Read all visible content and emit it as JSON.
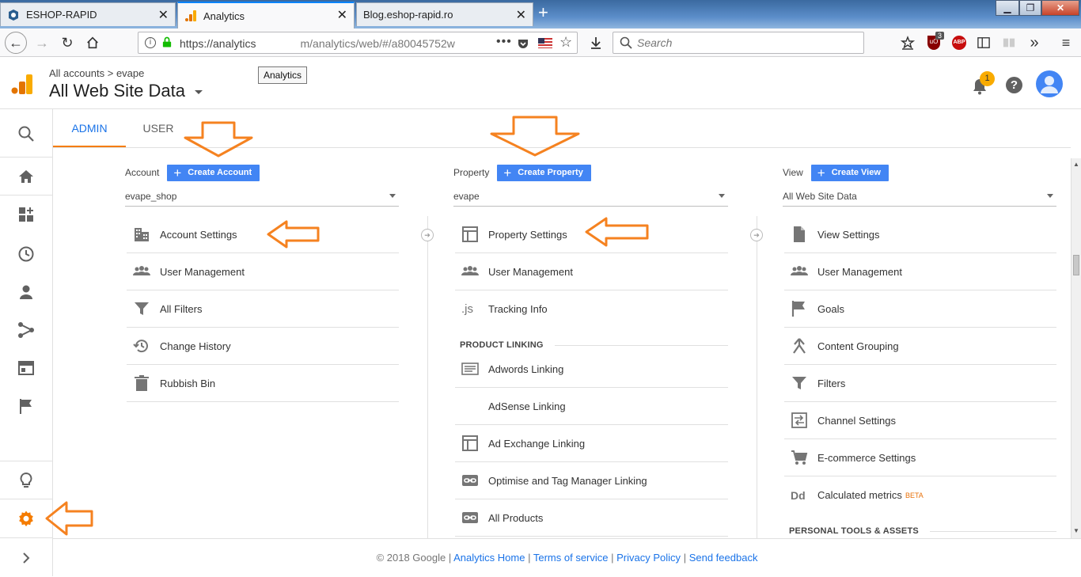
{
  "browser": {
    "tabs": [
      {
        "title": "ESHOP-RAPID"
      },
      {
        "title": "Analytics"
      },
      {
        "title": "Blog.eshop-rapid.ro"
      }
    ],
    "url": "https://analytics.google.com/analytics/web/#/a80045752w",
    "url_visible_start": "https://analytics",
    "url_visible_end": "m/analytics/web/#/a80045752w",
    "tooltip": "Analytics",
    "search_placeholder": "Search",
    "ublock_badge": "3",
    "abp_label": "ABP"
  },
  "ga_header": {
    "breadcrumb_root": "All accounts",
    "breadcrumb_sep": ">",
    "breadcrumb_account": "evape",
    "view_title": "All Web Site Data",
    "notification_count": "1"
  },
  "tabs": {
    "admin": "ADMIN",
    "user": "USER"
  },
  "account_col": {
    "label": "Account",
    "create_button": "Create Account",
    "selected": "evape_shop",
    "items": [
      {
        "label": "Account Settings",
        "icon": "building-icon"
      },
      {
        "label": "User Management",
        "icon": "people-icon"
      },
      {
        "label": "All Filters",
        "icon": "filter-icon"
      },
      {
        "label": "Change History",
        "icon": "history-icon"
      },
      {
        "label": "Rubbish Bin",
        "icon": "trash-icon"
      }
    ]
  },
  "property_col": {
    "label": "Property",
    "create_button": "Create Property",
    "selected": "evape",
    "items": [
      {
        "label": "Property Settings",
        "icon": "window-icon"
      },
      {
        "label": "User Management",
        "icon": "people-icon"
      },
      {
        "label": "Tracking Info",
        "icon": "js-icon",
        "icon_text": ".js"
      }
    ],
    "section_title": "PRODUCT LINKING",
    "linking_items": [
      {
        "label": "Adwords Linking",
        "icon": "adwords-icon"
      },
      {
        "label": "AdSense Linking",
        "icon": "adsense-icon"
      },
      {
        "label": "Ad Exchange Linking",
        "icon": "window-icon"
      },
      {
        "label": "Optimise and Tag Manager Linking",
        "icon": "link-icon"
      },
      {
        "label": "All Products",
        "icon": "link-icon"
      }
    ]
  },
  "view_col": {
    "label": "View",
    "create_button": "Create View",
    "selected": "All Web Site Data",
    "items": [
      {
        "label": "View Settings",
        "icon": "document-icon"
      },
      {
        "label": "User Management",
        "icon": "people-icon"
      },
      {
        "label": "Goals",
        "icon": "flag-icon"
      },
      {
        "label": "Content Grouping",
        "icon": "grouping-icon"
      },
      {
        "label": "Filters",
        "icon": "filter-icon"
      },
      {
        "label": "Channel Settings",
        "icon": "channel-icon"
      },
      {
        "label": "E-commerce Settings",
        "icon": "cart-icon"
      },
      {
        "label": "Calculated metrics",
        "icon": "dd-icon",
        "icon_text": "Dd",
        "badge": "BETA"
      }
    ],
    "section_title": "PERSONAL TOOLS & ASSETS"
  },
  "footer": {
    "copyright": "© 2018 Google",
    "sep": "|",
    "links": [
      "Analytics Home",
      "Terms of service",
      "Privacy Policy",
      "Send feedback"
    ]
  },
  "colors": {
    "accent_blue": "#4285f4",
    "link_blue": "#1a73e8",
    "annotation_orange": "#f58220",
    "ga_orange": "#f57c00",
    "ga_yellow": "#f9ab00"
  }
}
